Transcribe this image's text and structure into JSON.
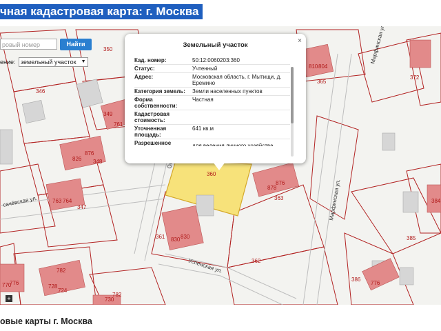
{
  "header": {
    "title": "чная кадастровая карта: г. Москва"
  },
  "search": {
    "placeholder": "ровый номер",
    "button_label": "Найти"
  },
  "layer": {
    "label": "ение:",
    "selected": "земельный участок"
  },
  "popup": {
    "title": "Земельный участок",
    "close_label": "×",
    "rows": [
      {
        "key": "Кад. номер:",
        "value": "50:12:0060203:360"
      },
      {
        "key": "Статус:",
        "value": "Учтенный"
      },
      {
        "key": "Адрес:",
        "value": "Московская область, г. Мытищи, д. Еремино"
      },
      {
        "key": "Категория земель:",
        "value": "Земли населенных пунктов"
      },
      {
        "key": "Форма собственности:",
        "value": "Частная"
      },
      {
        "key": "Кадастровая стоимость:",
        "value": ""
      },
      {
        "key": "Уточненная площадь:",
        "value": "641 кв.м"
      },
      {
        "key": "Разрешенное",
        "value": "для ведения личного хозяйства"
      }
    ]
  },
  "map": {
    "parcel_numbers": [
      "350",
      "372",
      "365",
      "346",
      "349",
      "761",
      "348",
      "826",
      "876",
      "347",
      "763",
      "764",
      "360",
      "876",
      "878",
      "363",
      "361",
      "830",
      "830",
      "384",
      "385",
      "362",
      "386",
      "776",
      "782",
      "728",
      "724",
      "770",
      "776",
      "730",
      "782",
      "761",
      "810",
      "804"
    ],
    "streets": [
      "Марфинская ул.",
      "Марфинская ул.",
      "сачёвская ул.",
      "Успенская ул.",
      "Ос"
    ],
    "selected_parcel": "360",
    "colors": {
      "selected": "#f7e27a",
      "building": "#e28a8a",
      "boundary": "#b22222"
    }
  },
  "footer": {
    "title": "овые карты г. Москва"
  }
}
